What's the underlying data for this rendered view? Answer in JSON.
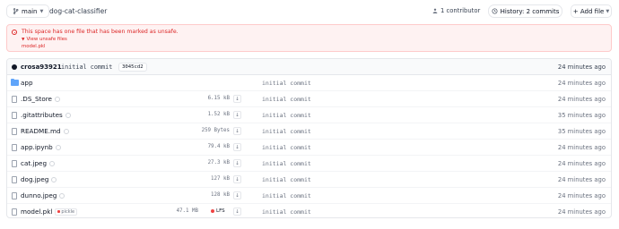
{
  "header": {
    "branch": "main",
    "repo_name": "dog-cat-classifier",
    "contributors": "1 contributor",
    "history": "History: 2 commits",
    "add_file": "+ Add file"
  },
  "unsafe_banner": {
    "message": "This space has one file that has been marked as unsafe.",
    "view_link": "View unsafe files",
    "file": "model.pkl"
  },
  "commit": {
    "author": "crosa93921",
    "message": "initial commit",
    "hash": "3045cd2",
    "time": "24 minutes ago"
  },
  "files": [
    {
      "name": "app",
      "type": "folder",
      "size": "",
      "commit": "initial commit",
      "time": "24 minutes ago"
    },
    {
      "name": ".DS_Store",
      "type": "file",
      "size": "6.15 kB",
      "commit": "initial commit",
      "time": "24 minutes ago"
    },
    {
      "name": ".gitattributes",
      "type": "file",
      "size": "1.52 kB",
      "commit": "initial commit",
      "time": "35 minutes ago"
    },
    {
      "name": "README.md",
      "type": "file",
      "size": "259 Bytes",
      "commit": "initial commit",
      "time": "35 minutes ago"
    },
    {
      "name": "app.ipynb",
      "type": "file",
      "size": "79.4 kB",
      "commit": "initial commit",
      "time": "24 minutes ago"
    },
    {
      "name": "cat.jpeg",
      "type": "file",
      "size": "27.3 kB",
      "commit": "initial commit",
      "time": "24 minutes ago"
    },
    {
      "name": "dog.jpeg",
      "type": "file",
      "size": "127 kB",
      "commit": "initial commit",
      "time": "24 minutes ago"
    },
    {
      "name": "dunno.jpeg",
      "type": "file",
      "size": "128 kB",
      "commit": "initial commit",
      "time": "24 minutes ago"
    },
    {
      "name": "model.pkl",
      "type": "file",
      "size": "47.1 MB",
      "badge": "pickle",
      "lfs": "LFS",
      "commit": "initial commit",
      "time": "24 minutes ago"
    }
  ],
  "colors": {
    "danger": "#dc2626",
    "folder": "#60a5fa",
    "border": "#e5e7eb"
  }
}
